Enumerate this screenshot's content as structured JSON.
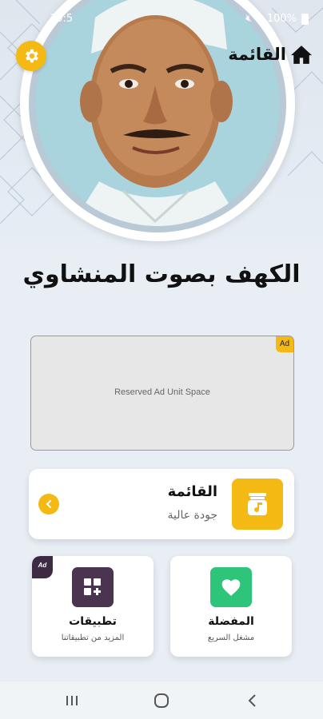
{
  "status_bar": {
    "time": "10:5 ",
    "battery": "100%"
  },
  "header": {
    "menu_label": "القائمة",
    "settings_icon": "gear-icon",
    "home_icon": "home-icon"
  },
  "title": "الكهف بصوت المنشاوي",
  "ad": {
    "text": "Reserved Ad Unit Space",
    "badge": "Ad"
  },
  "list_card": {
    "title": "القائمة",
    "subtitle": "جودة عالية",
    "icon": "music-jar-icon",
    "arrow_icon": "chevron-left-icon"
  },
  "tiles": [
    {
      "title": "تطبيقات",
      "subtitle": "المزيد من تطبيقاتنا",
      "icon": "apps-add-icon",
      "color": "#4a3450",
      "badge": "Ad"
    },
    {
      "title": "المفضلة",
      "subtitle": "مشغل السريع",
      "icon": "heart-icon",
      "color": "#2ec47a"
    }
  ],
  "colors": {
    "accent": "#f5b914",
    "background": "#e8eef4"
  },
  "nav": {
    "recent_icon": "recent-apps-icon",
    "home_icon": "home-circle-icon",
    "back_icon": "back-icon"
  }
}
